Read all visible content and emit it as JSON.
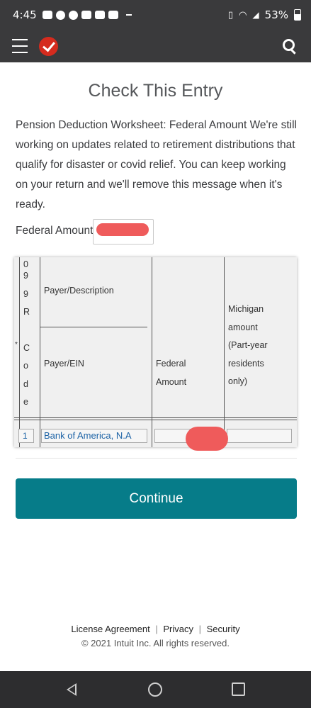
{
  "status_bar": {
    "time": "4:45",
    "battery": "53%"
  },
  "page": {
    "title": "Check This Entry",
    "message": "Pension Deduction Worksheet: Federal Amount We're still working on updates related to retirement distributions that qualify for disaster or covid relief. You can keep working on your return and we'll remove this message when it's ready.",
    "federal_amount_label": "Federal Amount"
  },
  "worksheet": {
    "code_letters": [
      "0",
      "9",
      "9",
      "R",
      "",
      "C",
      "o",
      "d",
      "e"
    ],
    "star": "*",
    "headers": {
      "payer_description": "Payer/Description",
      "payer_ein": "Payer/EIN",
      "federal_amount_line1": "Federal",
      "federal_amount_line2": "Amount",
      "michigan_lines": [
        "Michigan",
        "amount",
        "(Part-year",
        "residents",
        "only)"
      ]
    },
    "row": {
      "code": "1",
      "payer": "Bank of America, N.A"
    }
  },
  "actions": {
    "continue_label": "Continue"
  },
  "footer": {
    "license": "License Agreement",
    "privacy": "Privacy",
    "security": "Security",
    "separator": "|",
    "copyright": "© 2021 Intuit Inc. All rights reserved."
  }
}
